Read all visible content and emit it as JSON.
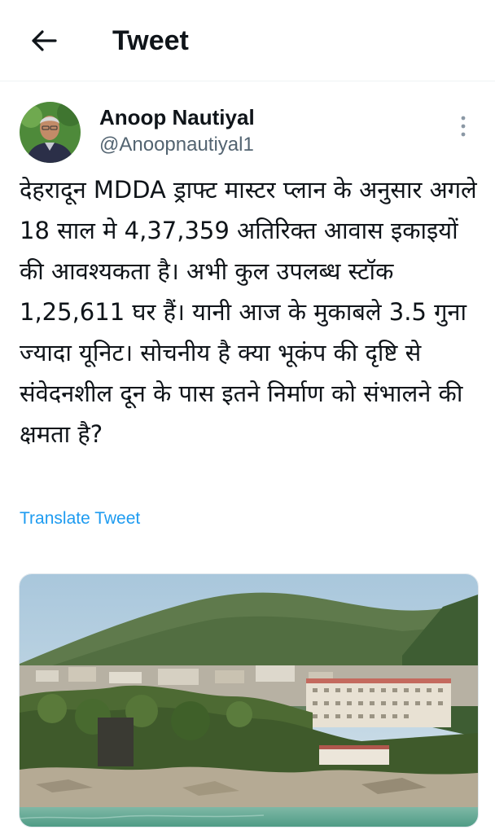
{
  "header": {
    "title": "Tweet"
  },
  "icons": {
    "back": "arrow-left-icon",
    "more": "more-vertical-icon"
  },
  "tweet": {
    "author_name": "Anoop Nautiyal",
    "author_handle": "@Anoopnautiyal1",
    "text": "देहरादून MDDA ड्राफ्ट मास्टर प्लान के अनुसार अगले 18 साल मे 4,37,359 अतिरिक्त आवास इकाइयों की आवश्यकता है। अभी कुल उपलब्ध स्टॉक 1,25,611 घर हैं। यानी आज के मुकाबले 3.5 गुना ज्यादा यूनिट। सोचनीय है क्या भूकंप की दृष्टि से संवेदनशील दून के पास इतने निर्माण को संभालने की क्षमता है?",
    "translate_label": "Translate Tweet"
  },
  "colors": {
    "link": "#1d9bf0",
    "secondary_text": "#536471",
    "primary_text": "#0f1419"
  }
}
